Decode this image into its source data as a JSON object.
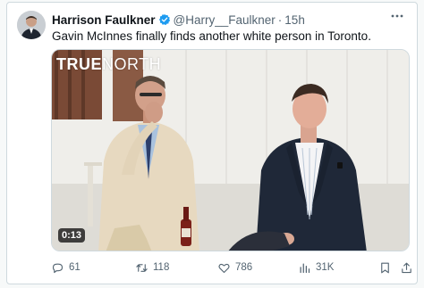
{
  "tweet": {
    "author_name": "Harrison Faulkner",
    "handle": "@Harry__Faulkner",
    "separator": "·",
    "time": "15h",
    "text": "Gavin McInnes finally finds another white person in Toronto."
  },
  "media": {
    "brand_part1": "TRUE",
    "brand_part2": "NORTH",
    "duration": "0:13"
  },
  "actions": {
    "replies": "61",
    "reposts": "118",
    "likes": "786",
    "views": "31K"
  },
  "colors": {
    "verified": "#1d9bf0",
    "muted": "#536471",
    "text": "#0f1419"
  }
}
